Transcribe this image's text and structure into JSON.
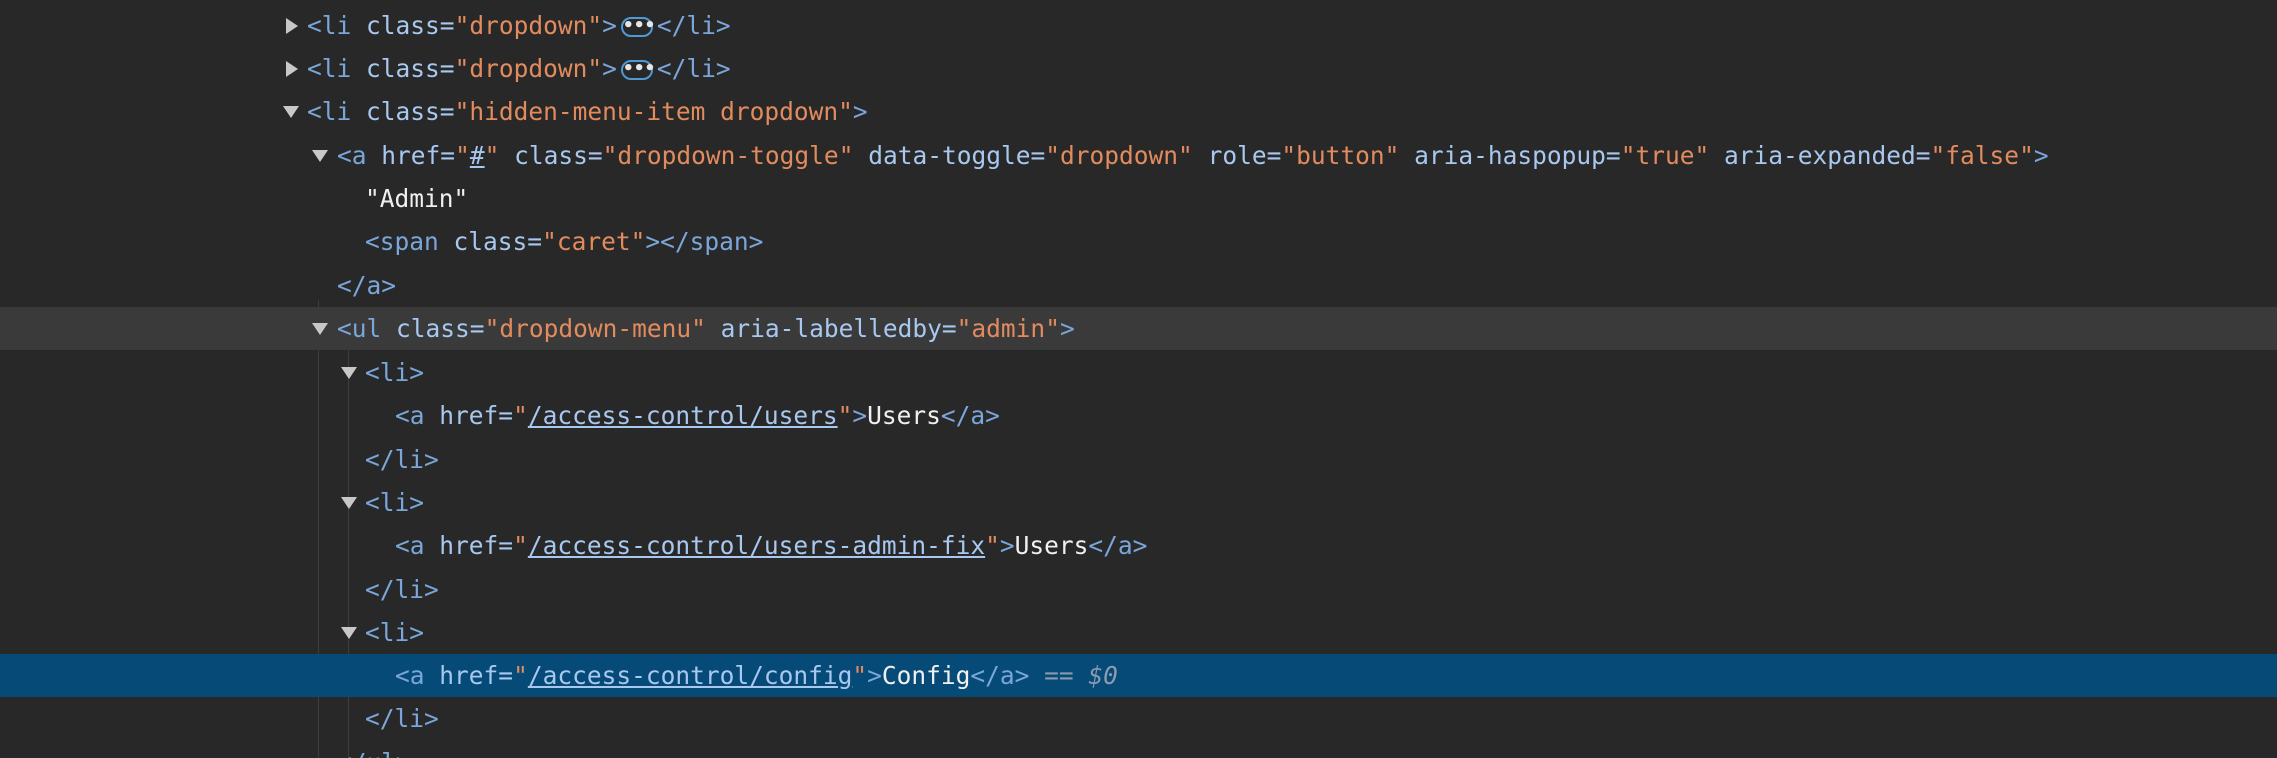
{
  "rows": [
    {
      "indent": 0,
      "toggle": "collapsed",
      "open": "<li",
      "attr": "class",
      "val": "dropdown",
      "after": ">",
      "ellipsis": "•••",
      "close": "</li>"
    },
    {
      "indent": 0,
      "toggle": "collapsed",
      "open": "<li",
      "attr": "class",
      "val": "dropdown",
      "after": ">",
      "ellipsis": "•••",
      "close": "</li>"
    },
    {
      "indent": 0,
      "toggle": "expanded",
      "open": "<li",
      "attr": "class",
      "val": "hidden-menu-item dropdown",
      "after": ">"
    },
    {
      "a_open": "<a",
      "attrs": [
        {
          "name": "href",
          "value": "#",
          "link": true
        },
        {
          "name": "class",
          "value": "dropdown-toggle"
        },
        {
          "name": "data-toggle",
          "value": "dropdown"
        },
        {
          "name": "role",
          "value": "button"
        },
        {
          "name": "aria-haspopup",
          "value": "true"
        },
        {
          "name": "aria-expanded",
          "value": "false"
        }
      ],
      "after": ">"
    },
    {
      "text": "\"Admin\""
    },
    {
      "span_open": "<span",
      "span_attr": "class",
      "span_val": "caret",
      "span_close": "></span>"
    },
    {
      "close": "</a>"
    },
    {
      "open": "<ul",
      "attr1": "class",
      "val1": "dropdown-menu",
      "attr2": "aria-labelledby",
      "val2": "admin",
      "after": ">"
    },
    {
      "open": "<li>"
    },
    {
      "a_open": "<a",
      "attr": "href",
      "href": "/access-control/users",
      "after": ">",
      "text": "Users",
      "close": "</a>"
    },
    {
      "close": "</li>"
    },
    {
      "open": "<li>"
    },
    {
      "a_open": "<a",
      "attr": "href",
      "href": "/access-control/users-admin-fix",
      "after": ">",
      "text": "Users",
      "close": "</a>"
    },
    {
      "close": "</li>"
    },
    {
      "open": "<li>"
    },
    {
      "a_open": "<a",
      "attr": "href",
      "href": "/access-control/config",
      "after": ">",
      "text": "Config",
      "close": "</a>",
      "marker": "== $0"
    },
    {
      "close": "</li>"
    },
    {
      "close": "</ul>"
    }
  ]
}
